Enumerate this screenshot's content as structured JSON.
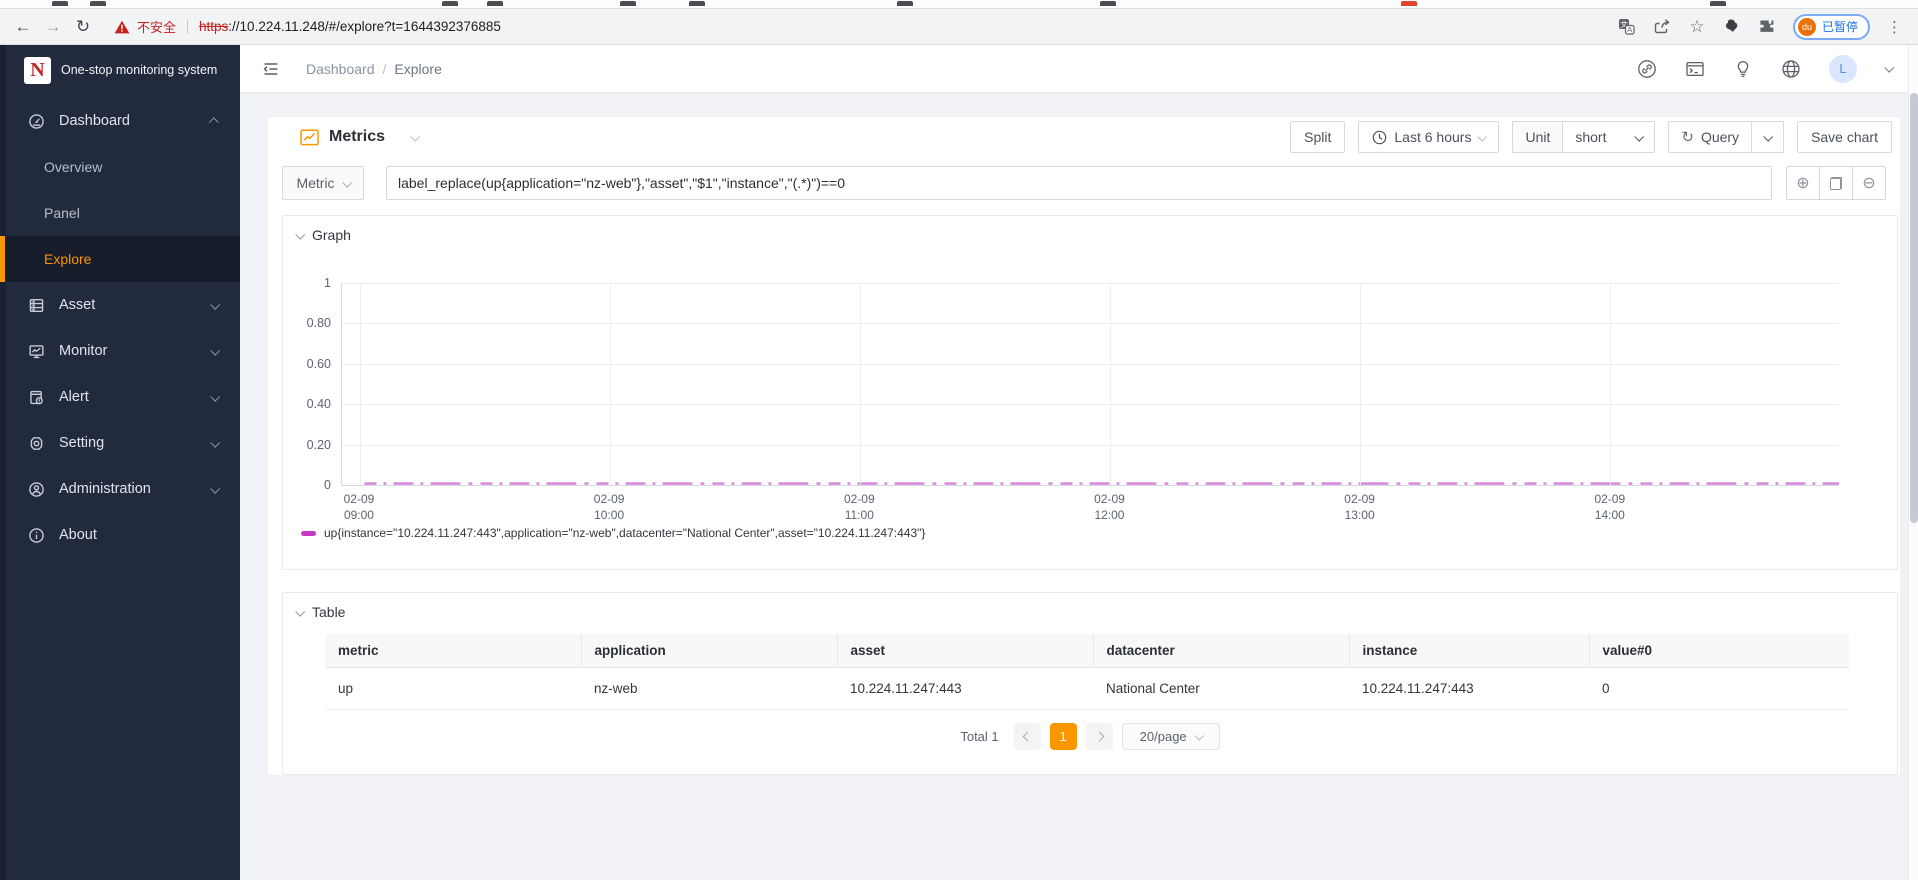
{
  "colors": {
    "accent": "#fa9600",
    "series_line": "#cf63d8",
    "legend_marker": "#c43ac4",
    "sidebar_bg": "#222b3e",
    "danger": "#c5221f"
  },
  "browser": {
    "security_warning": "不安全",
    "url_protocol": "https",
    "url_rest": "://10.224.11.248/#/explore?t=1644392376885",
    "profile_avatar": "du",
    "profile_status": "已暂停"
  },
  "sidebar": {
    "logo_text": "One-stop monitoring system",
    "items": [
      {
        "label": "Dashboard",
        "icon": "dashboard",
        "chevron": "up"
      },
      {
        "label": "Overview",
        "type": "sub"
      },
      {
        "label": "Panel",
        "type": "sub"
      },
      {
        "label": "Explore",
        "type": "sub",
        "active": true
      },
      {
        "label": "Asset",
        "icon": "asset",
        "chevron": "down"
      },
      {
        "label": "Monitor",
        "icon": "monitor",
        "chevron": "down"
      },
      {
        "label": "Alert",
        "icon": "alert",
        "chevron": "down"
      },
      {
        "label": "Setting",
        "icon": "setting",
        "chevron": "down"
      },
      {
        "label": "Administration",
        "icon": "administration",
        "chevron": "down"
      },
      {
        "label": "About",
        "icon": "about"
      }
    ]
  },
  "header": {
    "breadcrumb": {
      "items": [
        "Dashboard",
        "Explore"
      ],
      "separator": "/"
    },
    "avatar_letter": "L"
  },
  "toolbar": {
    "title": "Metrics",
    "split_label": "Split",
    "time_range": "Last 6 hours",
    "unit_label": "Unit",
    "unit_value": "short",
    "query_label": "Query",
    "save_label": "Save chart"
  },
  "query": {
    "metric_select": "Metric",
    "expression": "label_replace(up{application=\"nz-web\"},\"asset\",\"$1\",\"instance\",\"(.*)\")==0"
  },
  "graph_panel": {
    "title": "Graph"
  },
  "chart_data": {
    "type": "line",
    "title": "",
    "xlabel": "",
    "ylabel": "",
    "ylim": [
      0,
      1
    ],
    "grid": true,
    "legend_position": "bottom",
    "y_ticks": [
      "1",
      "0.80",
      "0.60",
      "0.40",
      "0.20",
      "0"
    ],
    "x_ticks": [
      {
        "date": "02-09",
        "time": "09:00"
      },
      {
        "date": "02-09",
        "time": "10:00"
      },
      {
        "date": "02-09",
        "time": "11:00"
      },
      {
        "date": "02-09",
        "time": "12:00"
      },
      {
        "date": "02-09",
        "time": "13:00"
      },
      {
        "date": "02-09",
        "time": "14:00"
      }
    ],
    "x_tick_fracs": [
      0.012,
      0.179,
      0.346,
      0.513,
      0.68,
      0.847
    ],
    "series": [
      {
        "name": "up{instance=\"10.224.11.247:443\",application=\"nz-web\",datacenter=\"National Center\",asset=\"10.224.11.247:443\"}",
        "color": "#cf63d8",
        "constant_value": 0,
        "values_note": "constant 0 across visible range, drawn as intermittent dashes at y=0",
        "x_start_frac": 0.015,
        "x_end_frac": 1.0,
        "dash_pattern": "12 7 3 7 20 7 3 7 30 8 4 8"
      }
    ]
  },
  "table_panel": {
    "title": "Table",
    "columns": [
      "metric",
      "application",
      "asset",
      "datacenter",
      "instance",
      "value#0"
    ],
    "rows": [
      [
        "up",
        "nz-web",
        "10.224.11.247:443",
        "National Center",
        "10.224.11.247:443",
        "0"
      ]
    ]
  },
  "pagination": {
    "total_label": "Total 1",
    "current_page": "1",
    "page_size": "20/page"
  },
  "icons": {
    "plus_circle": "⊕",
    "minus_circle": "⊖",
    "refresh": "↻",
    "star": "☆",
    "dots_menu": "⋮",
    "back": "←",
    "forward": "→",
    "reload": "↻"
  }
}
